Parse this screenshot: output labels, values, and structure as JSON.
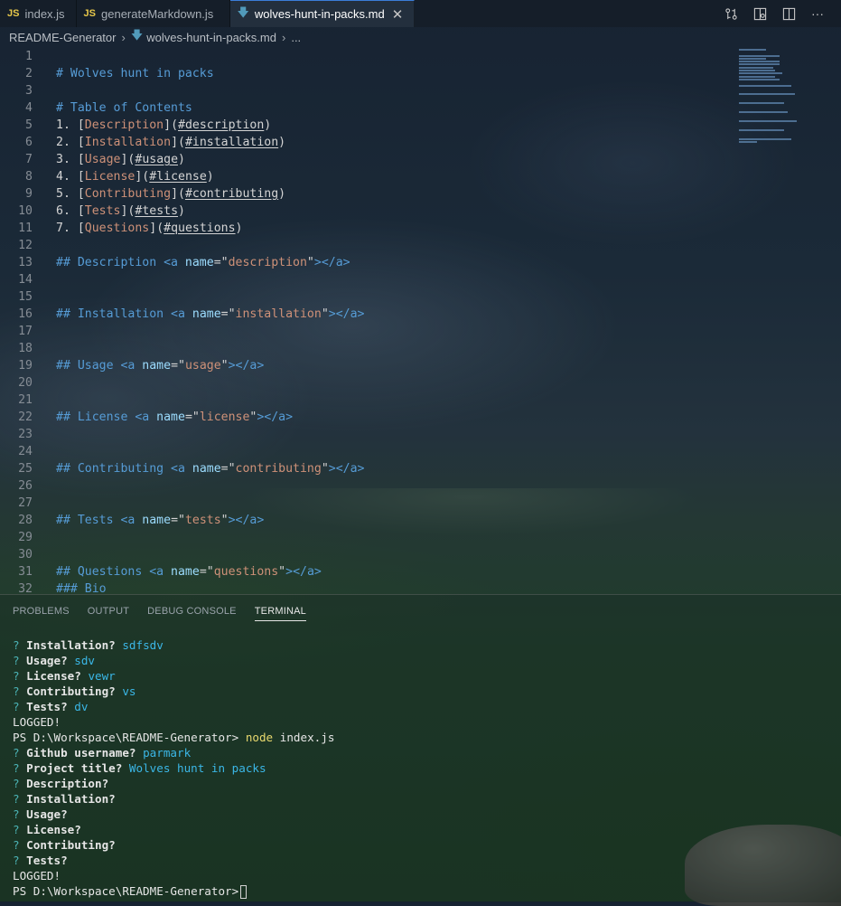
{
  "tabs": [
    {
      "icon": "JS",
      "label": "index.js",
      "active": false
    },
    {
      "icon": "JS",
      "label": "generateMarkdown.js",
      "active": false
    },
    {
      "icon": "md-icon",
      "label": "wolves-hunt-in-packs.md",
      "active": true
    }
  ],
  "breadcrumb": {
    "folder": "README-Generator",
    "file": "wolves-hunt-in-packs.md",
    "more": "..."
  },
  "editor": {
    "lines": [
      {
        "n": "1"
      },
      {
        "n": "2",
        "h": "# Wolves hunt in packs"
      },
      {
        "n": "3"
      },
      {
        "n": "4",
        "h": "# Table of Contents"
      },
      {
        "n": "5",
        "num": "1. ",
        "lt": "Description",
        "lk": "#description"
      },
      {
        "n": "6",
        "num": "2. ",
        "lt": "Installation",
        "lk": "#installation"
      },
      {
        "n": "7",
        "num": "3. ",
        "lt": "Usage",
        "lk": "#usage"
      },
      {
        "n": "8",
        "num": "4. ",
        "lt": "License",
        "lk": "#license"
      },
      {
        "n": "9",
        "num": "5. ",
        "lt": "Contributing",
        "lk": "#contributing"
      },
      {
        "n": "10",
        "num": "6. ",
        "lt": "Tests",
        "lk": "#tests"
      },
      {
        "n": "11",
        "num": "7. ",
        "lt": "Questions",
        "lk": "#questions"
      },
      {
        "n": "12"
      },
      {
        "n": "13",
        "h": "## Description ",
        "tag": "description"
      },
      {
        "n": "14"
      },
      {
        "n": "15"
      },
      {
        "n": "16",
        "h": "## Installation ",
        "tag": "installation"
      },
      {
        "n": "17"
      },
      {
        "n": "18"
      },
      {
        "n": "19",
        "h": "## Usage ",
        "tag": "usage"
      },
      {
        "n": "20"
      },
      {
        "n": "21"
      },
      {
        "n": "22",
        "h": "## License ",
        "tag": "license"
      },
      {
        "n": "23"
      },
      {
        "n": "24"
      },
      {
        "n": "25",
        "h": "## Contributing ",
        "tag": "contributing"
      },
      {
        "n": "26"
      },
      {
        "n": "27"
      },
      {
        "n": "28",
        "h": "## Tests ",
        "tag": "tests"
      },
      {
        "n": "29"
      },
      {
        "n": "30"
      },
      {
        "n": "31",
        "h": "## Questions ",
        "tag": "questions"
      },
      {
        "n": "32",
        "h": "### Bio"
      }
    ]
  },
  "panel": {
    "tabs": [
      "PROBLEMS",
      "OUTPUT",
      "DEBUG CONSOLE",
      "TERMINAL"
    ],
    "active_tab": "TERMINAL"
  },
  "terminal": {
    "lines": [
      {
        "type": "q",
        "label": "Installation?",
        "answer": "sdfsdv"
      },
      {
        "type": "q",
        "label": "Usage?",
        "answer": "sdv"
      },
      {
        "type": "q",
        "label": "License?",
        "answer": "vewr"
      },
      {
        "type": "q",
        "label": "Contributing?",
        "answer": "vs"
      },
      {
        "type": "q",
        "label": "Tests?",
        "answer": "dv"
      },
      {
        "type": "text",
        "text": "LOGGED!"
      },
      {
        "type": "prompt",
        "path": "PS D:\\Workspace\\README-Generator>",
        "cmd": "node",
        "args": "index.js"
      },
      {
        "type": "q",
        "label": "Github username?",
        "answer": "parmark"
      },
      {
        "type": "q",
        "label": "Project title?",
        "answer": "Wolves hunt in packs"
      },
      {
        "type": "q",
        "label": "Description?",
        "answer": ""
      },
      {
        "type": "q",
        "label": "Installation?",
        "answer": ""
      },
      {
        "type": "q",
        "label": "Usage?",
        "answer": ""
      },
      {
        "type": "q",
        "label": "License?",
        "answer": ""
      },
      {
        "type": "q",
        "label": "Contributing?",
        "answer": ""
      },
      {
        "type": "q",
        "label": "Tests?",
        "answer": ""
      },
      {
        "type": "text",
        "text": "LOGGED!"
      },
      {
        "type": "prompt",
        "path": "PS D:\\Workspace\\README-Generator>",
        "cmd": "",
        "args": "",
        "cursor": true
      }
    ]
  },
  "colors": {
    "heading": "#569cd6",
    "link_text": "#ce9178",
    "attr": "#9cdcfe",
    "string": "#ce9178",
    "answer": "#3bb7e7",
    "command": "#e8d96e",
    "accent": "#3b7dd8"
  }
}
